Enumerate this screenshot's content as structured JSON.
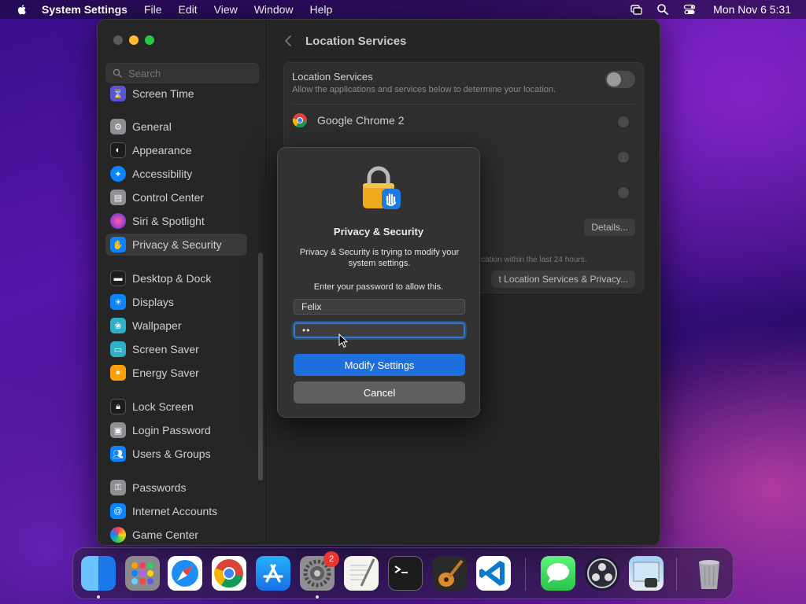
{
  "menubar": {
    "app_name": "System Settings",
    "menus": [
      "File",
      "Edit",
      "View",
      "Window",
      "Help"
    ],
    "clock": "Mon Nov 6  5:31"
  },
  "sidebar": {
    "search_placeholder": "Search",
    "items": [
      {
        "label": "Screen Time",
        "icon": "hourglass-icon",
        "color": "#5856d6"
      },
      {
        "label": "General",
        "icon": "gear-icon",
        "color": "#8e8e93"
      },
      {
        "label": "Appearance",
        "icon": "appearance-icon",
        "color": "#1c1c1e"
      },
      {
        "label": "Accessibility",
        "icon": "accessibility-icon",
        "color": "#0a84ff"
      },
      {
        "label": "Control Center",
        "icon": "control-center-icon",
        "color": "#8e8e93"
      },
      {
        "label": "Siri & Spotlight",
        "icon": "siri-icon",
        "color": "#c0359b"
      },
      {
        "label": "Privacy & Security",
        "icon": "hand-icon",
        "color": "#0a84ff"
      },
      {
        "label": "Desktop & Dock",
        "icon": "dock-icon",
        "color": "#1c1c1e"
      },
      {
        "label": "Displays",
        "icon": "sun-icon",
        "color": "#0a84ff"
      },
      {
        "label": "Wallpaper",
        "icon": "wallpaper-icon",
        "color": "#30b0c7"
      },
      {
        "label": "Screen Saver",
        "icon": "screensaver-icon",
        "color": "#30b0c7"
      },
      {
        "label": "Energy Saver",
        "icon": "bulb-icon",
        "color": "#ff9f0a"
      },
      {
        "label": "Lock Screen",
        "icon": "lock-icon",
        "color": "#1c1c1e"
      },
      {
        "label": "Login Password",
        "icon": "lock-icon",
        "color": "#8e8e93"
      },
      {
        "label": "Users & Groups",
        "icon": "users-icon",
        "color": "#0a84ff"
      },
      {
        "label": "Passwords",
        "icon": "key-icon",
        "color": "#8e8e93"
      },
      {
        "label": "Internet Accounts",
        "icon": "at-icon",
        "color": "#0a84ff"
      },
      {
        "label": "Game Center",
        "icon": "game-center-icon",
        "color": "#ff375f"
      }
    ]
  },
  "main": {
    "title": "Location Services",
    "location_services": {
      "title": "Location Services",
      "description": "Allow the applications and services below to determine your location."
    },
    "apps": [
      "Google Chrome 2"
    ],
    "details_label": "Details...",
    "hint": "cation within the last 24 hours.",
    "about_label": "t Location Services & Privacy..."
  },
  "dialog": {
    "title": "Privacy & Security",
    "message": "Privacy & Security is trying to modify your system settings.",
    "prompt": "Enter your password to allow this.",
    "username": "Felix",
    "password_mask": "••",
    "primary_label": "Modify Settings",
    "secondary_label": "Cancel"
  },
  "dock": {
    "settings_badge": "2",
    "apps": [
      "Finder",
      "Launchpad",
      "Safari",
      "Chrome",
      "App Store",
      "System Settings",
      "TextEdit",
      "Terminal",
      "GarageBand",
      "VS Code",
      "Messages",
      "OBS",
      "Preview",
      "Trash"
    ]
  }
}
